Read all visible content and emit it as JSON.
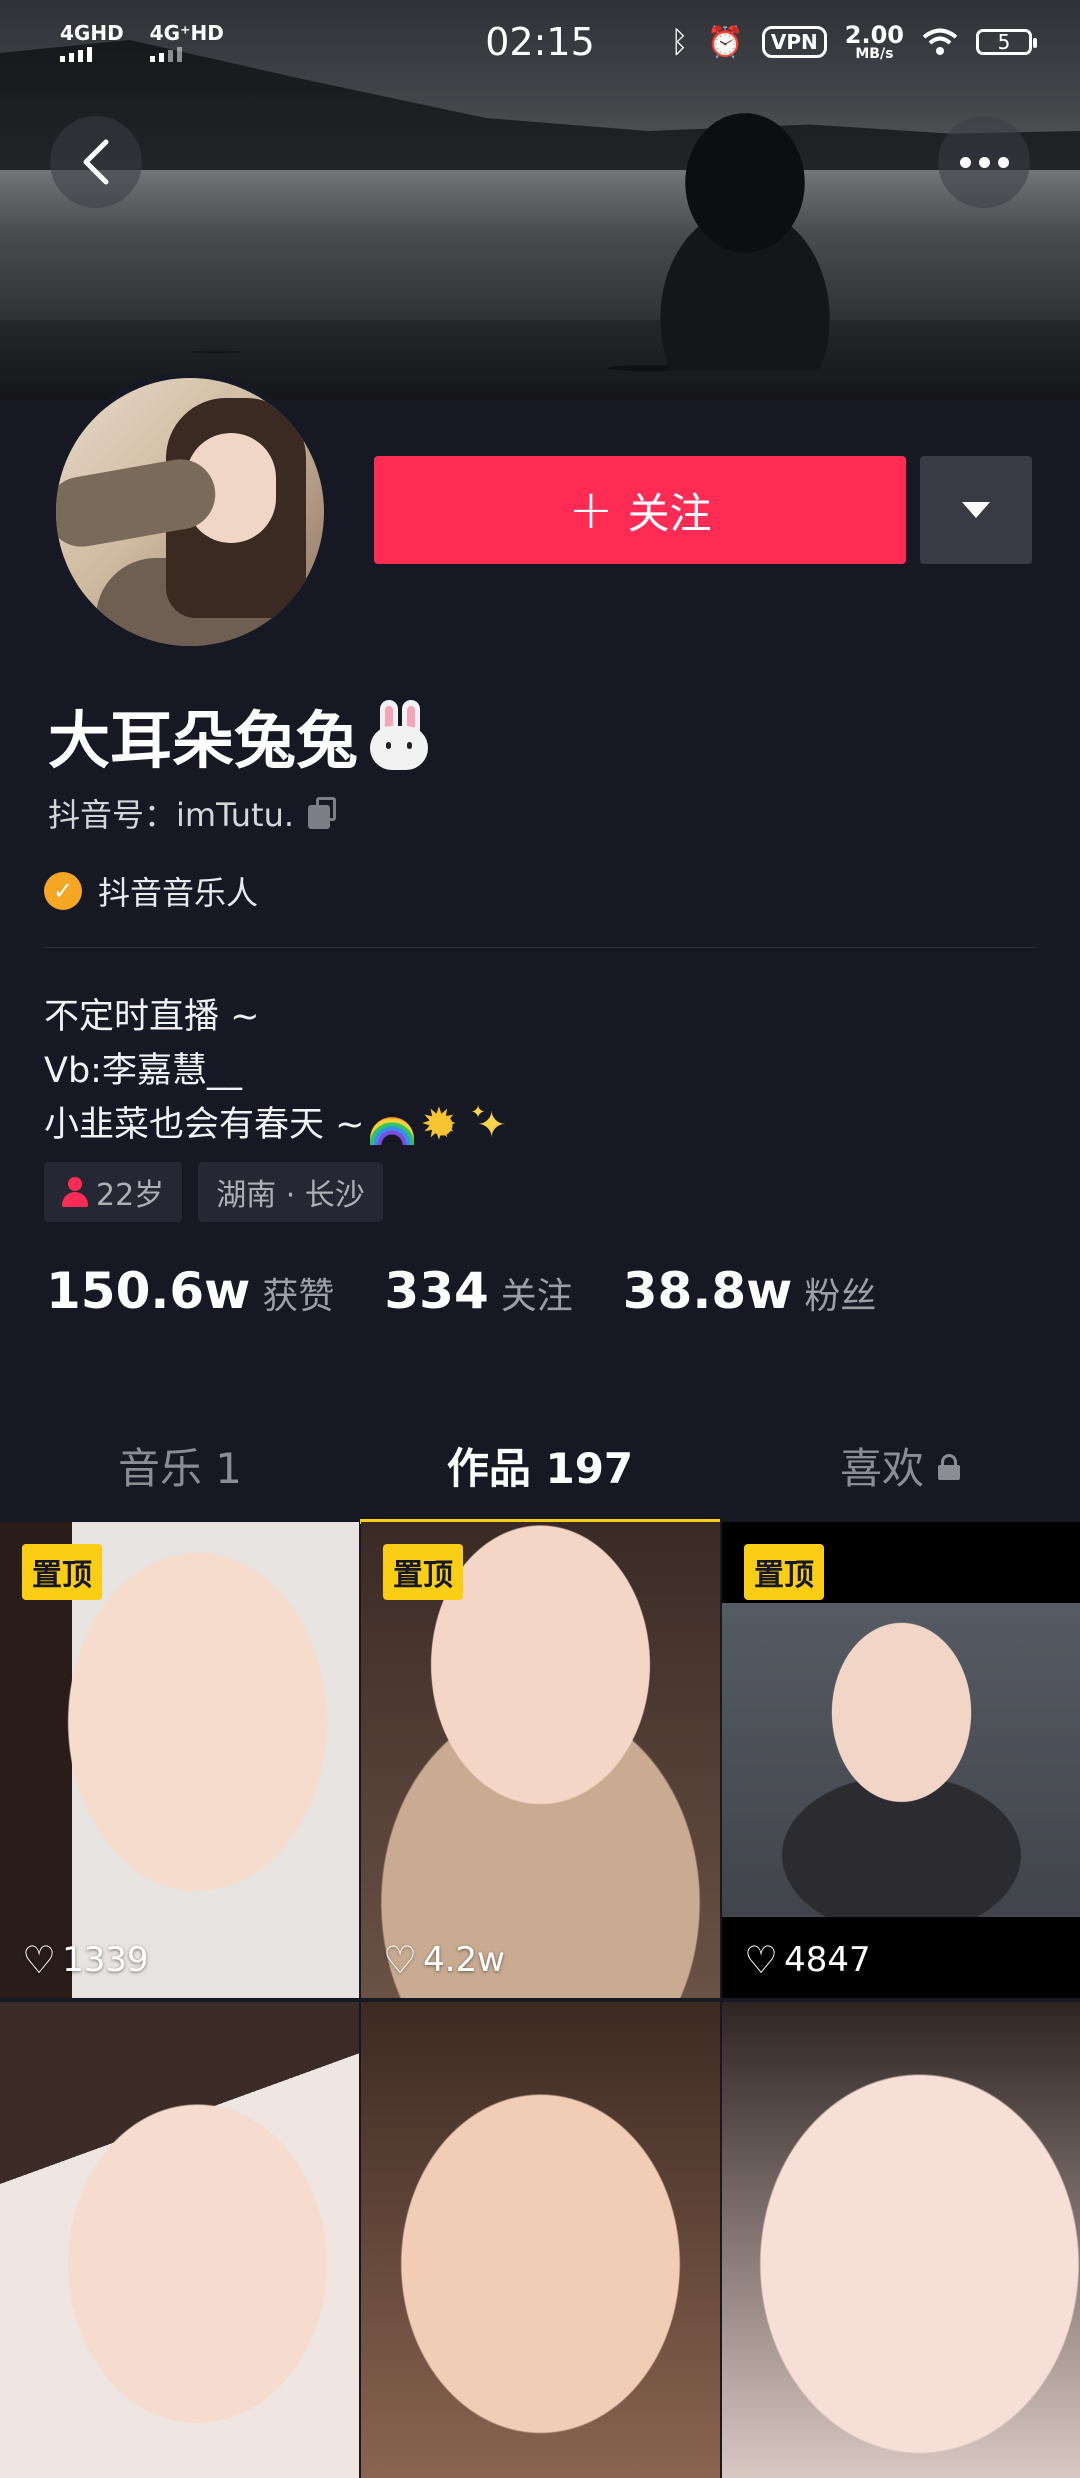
{
  "status_bar": {
    "sim1": "4GHD",
    "sim2": "4G⁺HD",
    "time": "02:15",
    "vpn": "VPN",
    "speed_value": "2.00",
    "speed_unit": "MB/s",
    "battery": "5"
  },
  "profile": {
    "follow_label": "关注",
    "nickname": "大耳朵兔兔",
    "uid": "抖音号：imTutu.",
    "verification": "抖音音乐人",
    "bio_lines": [
      "不定时直播 ~",
      "Vb:李嘉慧__",
      "小韭菜也会有春天 ~"
    ],
    "tags": {
      "age": "22岁",
      "location": "湖南 · 长沙"
    },
    "stats": [
      {
        "value": "150.6w",
        "label": "获赞"
      },
      {
        "value": "334",
        "label": "关注"
      },
      {
        "value": "38.8w",
        "label": "粉丝"
      }
    ]
  },
  "tabs": [
    {
      "label": "音乐 1"
    },
    {
      "label": "作品 197"
    },
    {
      "label": "喜欢"
    }
  ],
  "videos": [
    {
      "pinned": "置顶",
      "likes": "1339"
    },
    {
      "pinned": "置顶",
      "likes": "4.2w"
    },
    {
      "pinned": "置顶",
      "likes": "4847"
    },
    {
      "pinned": "",
      "likes": ""
    },
    {
      "pinned": "",
      "likes": ""
    },
    {
      "pinned": "",
      "likes": ""
    }
  ],
  "colors": {
    "accent": "#fe2c55",
    "tab_indicator": "#face15",
    "background": "#161823"
  },
  "icons": [
    "back-icon",
    "more-icon",
    "dropdown-icon",
    "copy-icon",
    "verified-icon",
    "person-icon",
    "lock-icon",
    "heart-icon"
  ]
}
